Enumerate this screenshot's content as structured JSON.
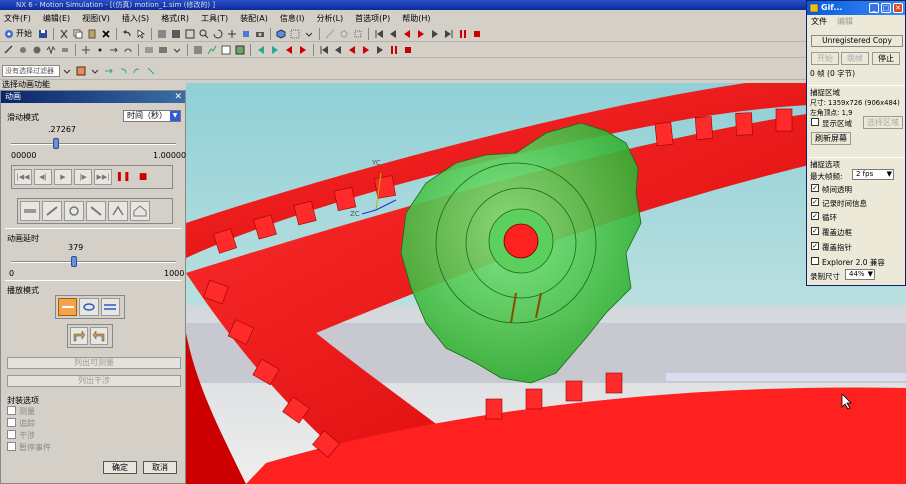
{
  "titlebar": {
    "text": "NX 6 - Motion Simulation - [(仿真) motion_1.sim (修改的) ]"
  },
  "menubar": {
    "items": [
      "文件(F)",
      "编辑(E)",
      "视图(V)",
      "插入(S)",
      "格式(R)",
      "工具(T)",
      "装配(A)",
      "信息(I)",
      "分析(L)",
      "首选项(P)",
      "帮助(H)"
    ]
  },
  "toolbar": {
    "start_label": "开始",
    "filter_value": "没有选择过滤器"
  },
  "anim_header": "选择动画功能",
  "anim_dialog": {
    "title": "动画",
    "slide_mode_label": "滑动模式",
    "slide_mode_value": "时间（秒）",
    "time_value": ".27267",
    "time_min": "00000",
    "time_max": "1.00000",
    "time_fraction": 0.27,
    "delay_label": "动画延时",
    "delay_value": "379",
    "delay_min": "0",
    "delay_max": "1000",
    "delay_fraction": 0.379,
    "play_mode_label": "播放模式",
    "list_btn1": "列出可测量",
    "list_btn2": "列出干涉",
    "pkg_options_label": "封装选项",
    "checkboxes": [
      "测量",
      "追踪",
      "干涉",
      "暂停事件"
    ],
    "ok_label": "确定",
    "cancel_label": "取消"
  },
  "gif": {
    "title": "Gif...",
    "menu_file": "文件",
    "menu_edit": "编辑",
    "unregistered": "Unregistered Copy",
    "btn_start": "开始",
    "btn_skip": "跳帧",
    "btn_stop": "停止",
    "frames": "0 帧 (0 字节)",
    "capture_area_label": "捕捉区域",
    "size_label": "尺寸: 1359x726 (906x484)",
    "topleft_label": "左角顶点:     1,9",
    "show_area_label": "显示区域",
    "select_area_btn": "选择区域",
    "refresh_btn": "刷新屏幕",
    "capture_opts_label": "捕捉选项",
    "max_fps_label": "最大帧频:",
    "max_fps_value": "2 fps",
    "opts": [
      "帧间透明",
      "记录时间信息",
      "循环",
      "覆盖边框",
      "覆盖指针",
      "Explorer 2.0 兼容"
    ],
    "opts_checked": [
      true,
      true,
      true,
      true,
      true,
      false
    ],
    "rec_size_label": "录制尺寸",
    "rec_size_value": "44%"
  },
  "viewport": {
    "axis_labels": [
      "YC",
      "ZC"
    ]
  },
  "colors": {
    "ring_gear": "#ff1a1a",
    "pinion": "#3ec83e",
    "bg_top": "#8fd0d6",
    "bg_bottom": "#e0e0e0"
  }
}
